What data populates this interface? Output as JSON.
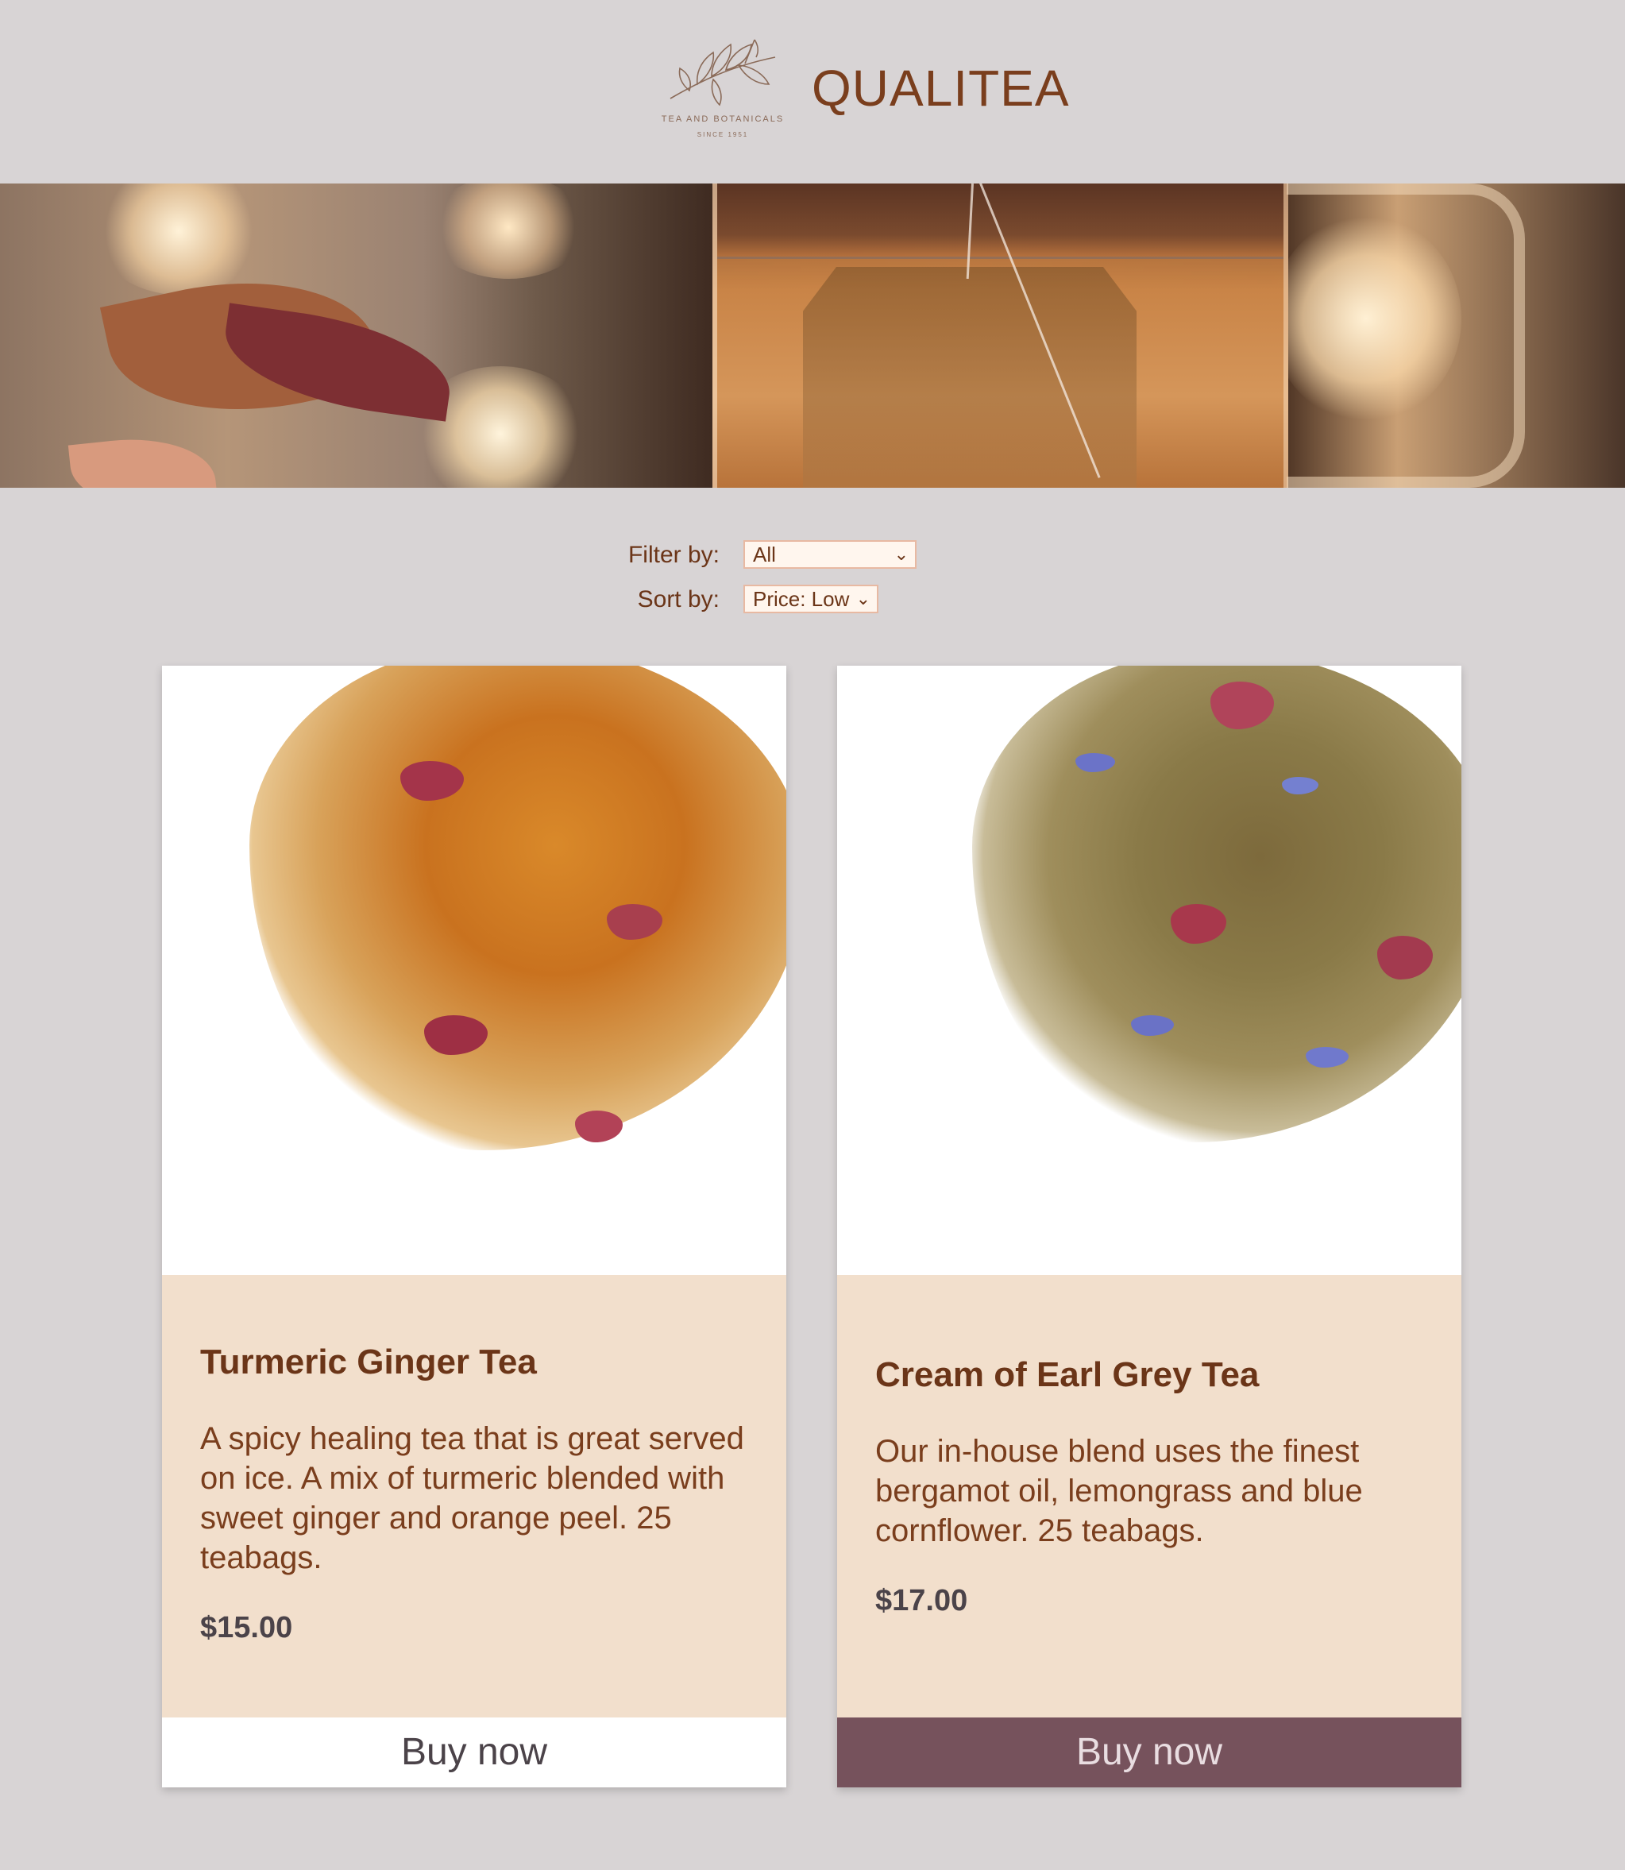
{
  "header": {
    "brand_name": "QUALITEA",
    "logo_tagline": "TEA AND BOTANICALS",
    "logo_since": "SINCE 1951"
  },
  "controls": {
    "filter_label": "Filter by:",
    "filter_value": "All",
    "sort_label": "Sort by:",
    "sort_value": "Price: Low"
  },
  "products": [
    {
      "name": "Turmeric Ginger Tea",
      "description": "A spicy healing tea that is great served on ice. A mix of turmeric blended with sweet ginger and orange peel. 25 teabags.",
      "price": "$15.00",
      "buy_label": "Buy now",
      "button_style": "light"
    },
    {
      "name": "Cream of Earl Grey Tea",
      "description": "Our in-house blend uses the finest bergamot oil, lemongrass and blue cornflower. 25 teabags.",
      "price": "$17.00",
      "buy_label": "Buy now",
      "button_style": "dark"
    }
  ],
  "colors": {
    "page_background": "#d8d4d5",
    "card_body": "#f2dfcc",
    "brand_text": "#7a3e1d",
    "buy_button_dark": "#76525c",
    "buy_button_light": "#ffffff"
  },
  "icons": {
    "logo": "tea-branch-icon",
    "dropdown": "chevron-down-icon"
  }
}
